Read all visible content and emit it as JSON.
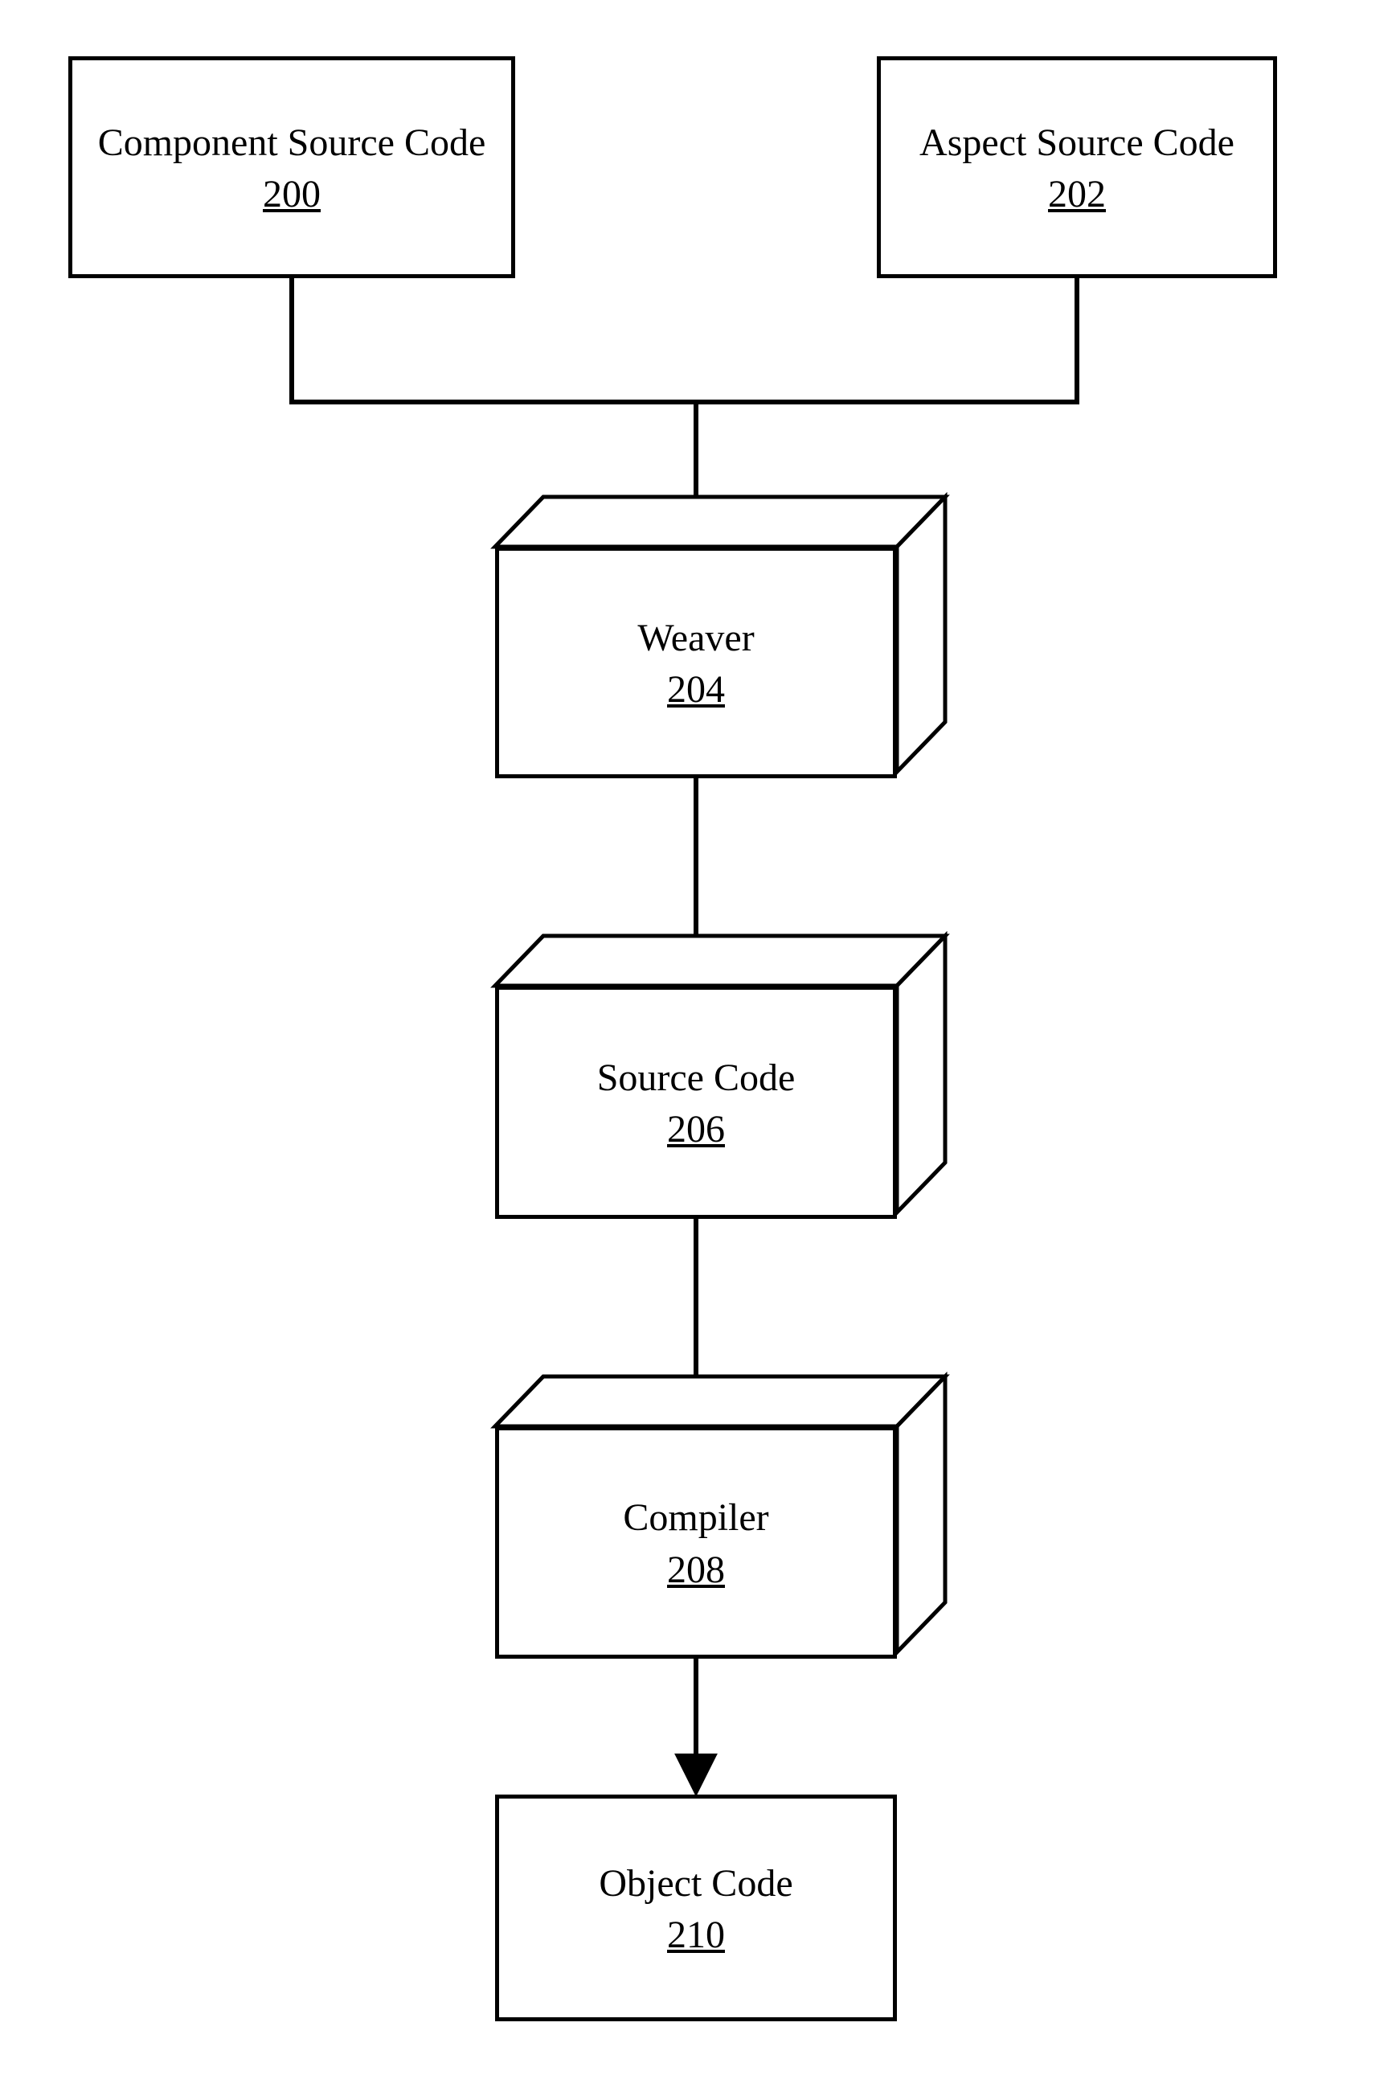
{
  "chart_data": {
    "type": "flow-diagram",
    "nodes": [
      {
        "id": "200",
        "label": "Component Source Code",
        "shape": "rect"
      },
      {
        "id": "202",
        "label": "Aspect Source Code",
        "shape": "rect"
      },
      {
        "id": "204",
        "label": "Weaver",
        "shape": "cuboid"
      },
      {
        "id": "206",
        "label": "Source Code",
        "shape": "cuboid"
      },
      {
        "id": "208",
        "label": "Compiler",
        "shape": "cuboid"
      },
      {
        "id": "210",
        "label": "Object Code",
        "shape": "rect"
      }
    ],
    "edges": [
      {
        "from": "200",
        "to": "204"
      },
      {
        "from": "202",
        "to": "204"
      },
      {
        "from": "204",
        "to": "206"
      },
      {
        "from": "206",
        "to": "208"
      },
      {
        "from": "208",
        "to": "210"
      }
    ]
  },
  "boxes": {
    "csc": {
      "label": "Component Source Code",
      "id": "200"
    },
    "asc": {
      "label": "Aspect Source Code",
      "id": "202"
    },
    "weav": {
      "label": "Weaver",
      "id": "204"
    },
    "sc": {
      "label": "Source Code",
      "id": "206"
    },
    "comp": {
      "label": "Compiler",
      "id": "208"
    },
    "obj": {
      "label": "Object Code",
      "id": "210"
    }
  }
}
